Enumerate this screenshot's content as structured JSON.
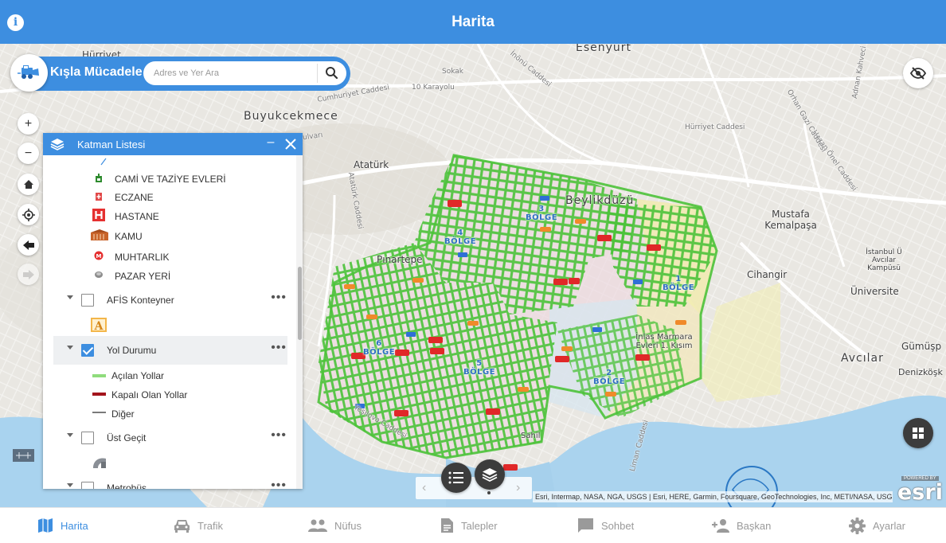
{
  "app": {
    "title": "Harita"
  },
  "search": {
    "app_name": "Kışla Mücadele",
    "placeholder": "Adres ve Yer Ara"
  },
  "map": {
    "labels": {
      "esenyurt": "Esenyurt",
      "buyukcekmece": "Buyukcekmece",
      "hurriyet": "Hürriyet",
      "ataturk": "Atatürk",
      "beylikduzu": "Beylikdüzü",
      "pinartepe": "Pınartepe",
      "mustafa_kemalpasa": "Mustafa Kemalpaşa",
      "cihangir": "Cihangir",
      "avcilar": "Avcılar",
      "gumusp": "Gümüşp",
      "denizkosk": "Denizköşk",
      "universite": "Üniversite",
      "istanbul_u": "İstanbul Ü Avcılar Kampüsü",
      "inlas": "İnlas Marmara Evleri 1. Kısım",
      "sahil": "Sahil",
      "road_1": "İnönü Caddesi",
      "road_2": "Cumhuriyet Caddesi",
      "road_3": "Yavuz Selim Bulvarı",
      "road_4": "Atatürk Caddesi",
      "road_5": "Hasan Önel Caddesi",
      "road_6": "Yeşilova Caddesi",
      "road_7": "Liman Caddesi",
      "road_8": "Orhan Gazi Caddesi",
      "road_9": "Adnan Kahveci Bulvarı",
      "road_10": "Hürriyet Caddesi",
      "road_11": "10 Karayolu",
      "road_12": "Sokak",
      "bolge_1": "1 BÖLGE",
      "bolge_2": "2 BÖLGE",
      "bolge_3": "3 BÖLGE",
      "bolge_4": "4 BÖLGE",
      "bolge_5": "5 BÖLGE",
      "bolge_6": "6 BÖLGE"
    },
    "green_road_color": "#4cc23a",
    "attribution": "Esri, Intermap, NASA, NGA, USGS | Esri, HERE, Garmin, Foursquare, GeoTechnologies, Inc, METI/NASA, USGS",
    "esri_powered": "POWERED BY",
    "esri_word": "esri"
  },
  "layer_panel": {
    "title": "Katman Listesi",
    "legend_top": [
      {
        "icon": "mosque-icon",
        "label": "CAMİ VE TAZİYE EVLERİ"
      },
      {
        "icon": "pharmacy-icon",
        "label": "ECZANE"
      },
      {
        "icon": "hospital-icon",
        "label": "HASTANE"
      },
      {
        "icon": "government-icon",
        "label": "KAMU"
      },
      {
        "icon": "municipality-icon",
        "label": "MUHTARLIK"
      },
      {
        "icon": "bazaar-icon",
        "label": "PAZAR YERİ"
      }
    ],
    "layers": [
      {
        "name": "AFİS Konteyner",
        "checked": false
      },
      {
        "name": "Yol Durumu",
        "checked": true
      },
      {
        "name": "Üst Geçit",
        "checked": false
      },
      {
        "name": "Metrobüs",
        "checked": false
      }
    ],
    "yol_legend": [
      {
        "label": "Açılan Yollar",
        "color": "#8fdc7c"
      },
      {
        "label": "Kapalı Olan Yollar",
        "color": "#a3141c"
      },
      {
        "label": "Diğer",
        "color": "#7a7a7a"
      }
    ],
    "more": "•••"
  },
  "nav": [
    {
      "label": "Harita",
      "icon": "map-icon",
      "active": true
    },
    {
      "label": "Trafik",
      "icon": "car-icon",
      "active": false
    },
    {
      "label": "Nüfus",
      "icon": "people-icon",
      "active": false
    },
    {
      "label": "Talepler",
      "icon": "document-icon",
      "active": false
    },
    {
      "label": "Sohbet",
      "icon": "chat-icon",
      "active": false
    },
    {
      "label": "Başkan",
      "icon": "person-add-icon",
      "active": false
    },
    {
      "label": "Ayarlar",
      "icon": "gear-icon",
      "active": false
    }
  ],
  "colors": {
    "primary": "#3d8ee0",
    "nav_inactive": "#9a9a9a"
  }
}
